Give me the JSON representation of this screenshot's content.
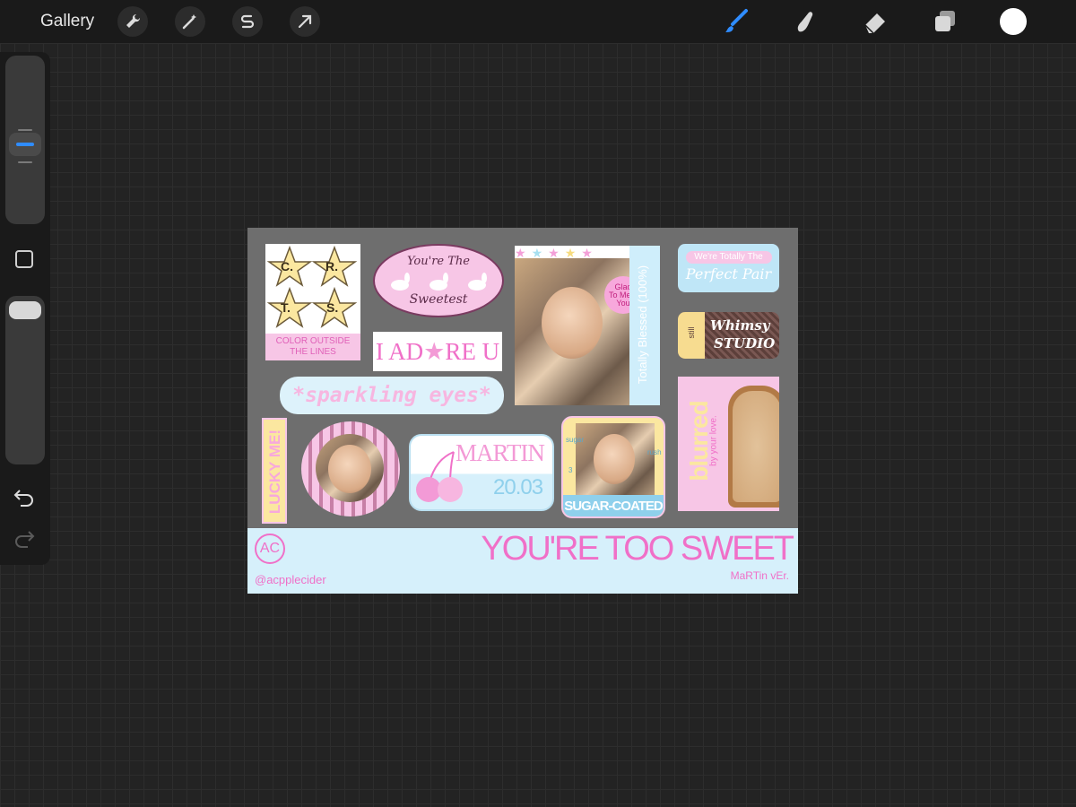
{
  "toolbar": {
    "gallery_label": "Gallery",
    "left_tools": [
      "wrench-icon",
      "magic-wand-icon",
      "selection-icon",
      "transform-arrow-icon"
    ],
    "right_tools": [
      "brush-icon",
      "smudge-icon",
      "eraser-icon",
      "layers-icon"
    ],
    "active_tool": "brush-icon",
    "current_color": "#ffffff",
    "accent_color": "#2f8cff"
  },
  "sidebar": {
    "size_slider_icon": "brush-size-slider",
    "modify_icon": "square-modifier-icon",
    "undo_icon": "undo-icon",
    "redo_icon": "redo-icon"
  },
  "canvas": {
    "crts": {
      "letters": [
        "C.",
        "R.",
        "T.",
        "S."
      ],
      "caption_line1": "COLOR OUTSIDE",
      "caption_line2": "THE LINES"
    },
    "sweetest": {
      "line1": "You're The",
      "line2": "Sweetest"
    },
    "adore": {
      "text_left": "I AD",
      "text_right": "RE U"
    },
    "sparkling": {
      "text": "*sparkling eyes*"
    },
    "photo_poster": {
      "badge_line1": "Glad",
      "badge_line2": "To Meet",
      "badge_line3": "You",
      "side_text": "Totally Blessed (100%)"
    },
    "perfect_pair": {
      "line1": "We're Totally The",
      "line2": "Perfect Pair"
    },
    "whimsy": {
      "line1": "Whimsy",
      "line2": "STUDIO",
      "tag": "still"
    },
    "blurred": {
      "big": "blurred",
      "small": "by your love."
    },
    "lucky": {
      "text": "LUCKY ME!"
    },
    "martin_ticket": {
      "name": "MARTIN",
      "date": "20.03"
    },
    "sugar": {
      "caption": "SUGAR-COATED",
      "tag_left": "sugar",
      "tag_right": "rush",
      "tag_num": "3"
    },
    "footer": {
      "logo": "AC",
      "handle": "@acpplecider",
      "title": "YOU'RE TOO SWEET",
      "subtitle": "MaRTin vEr."
    },
    "colors": {
      "pink": "#f070c8",
      "baby_blue": "#d6f0fb",
      "cream": "#fbe9a7",
      "light_pink": "#f7c6e6"
    }
  }
}
